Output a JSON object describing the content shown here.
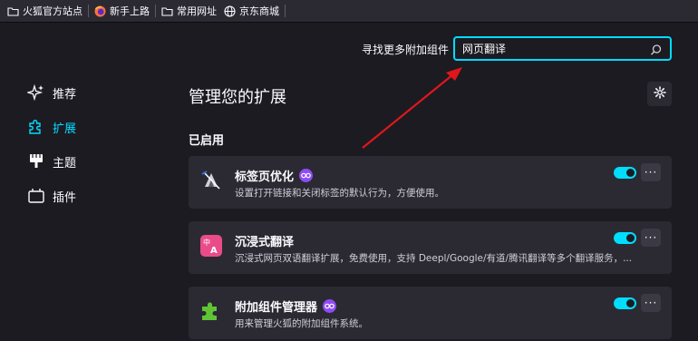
{
  "bookmarks": [
    {
      "label": "火狐官方站点",
      "icon": "folder-icon"
    },
    {
      "label": "新手上路",
      "icon": "firefox-icon"
    },
    {
      "label": "常用网址",
      "icon": "folder-icon"
    },
    {
      "label": "京东商城",
      "icon": "globe-icon"
    }
  ],
  "search": {
    "label": "寻找更多附加组件",
    "value": "网页翻译"
  },
  "nav": [
    {
      "label": "推荐",
      "icon": "sparkle-icon"
    },
    {
      "label": "扩展",
      "icon": "puzzle-icon"
    },
    {
      "label": "主题",
      "icon": "brush-icon"
    },
    {
      "label": "插件",
      "icon": "plugin-icon"
    }
  ],
  "main": {
    "title": "管理您的扩展",
    "section": "已启用"
  },
  "extensions": [
    {
      "name": "标签页优化",
      "desc": "设置打开链接和关闭标签的默认行为，方便使用。",
      "recommended": true,
      "enabled": true
    },
    {
      "name": "沉浸式翻译",
      "desc": "沉浸式网页双语翻译扩展，免费使用，支持 Deepl/Google/有道/腾讯翻译等多个翻译服务，...",
      "recommended": false,
      "enabled": true
    },
    {
      "name": "附加组件管理器",
      "desc": "用来管理火狐的附加组件系统。",
      "recommended": true,
      "enabled": true
    }
  ],
  "more_label": "···",
  "colors": {
    "accent": "#00ddff",
    "badge": "#8f4bf6",
    "arrow": "#e0161b"
  }
}
